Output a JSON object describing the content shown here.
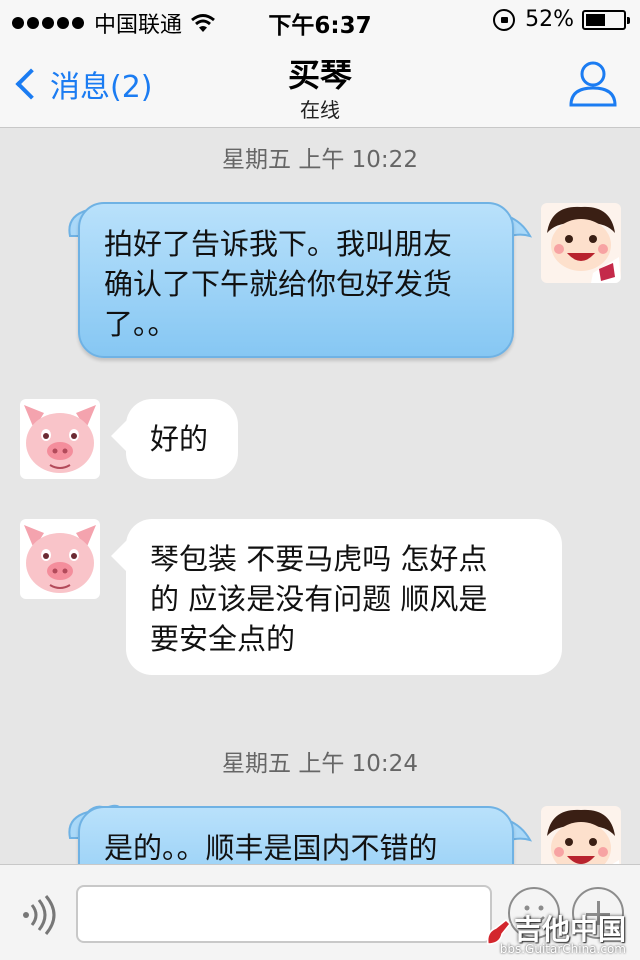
{
  "status_bar": {
    "carrier": "中国联通",
    "time": "下午6:37",
    "battery_percent": "52%",
    "battery_level": 0.52
  },
  "nav": {
    "back_label": "消息(2)",
    "title": "买琴",
    "subtitle": "在线"
  },
  "messages": {
    "ts1": "星期五 上午 10:22",
    "m1": {
      "line1": "拍好了告诉我下。我叫朋友",
      "line2": "确认了下午就给你包好发货",
      "line3": "了。。"
    },
    "m2": {
      "line1": "好的"
    },
    "m3": {
      "line1": "琴包装 不要马虎吗 怎好点",
      "line2": "的 应该是没有问题 顺风是",
      "line3": "要安全点的"
    },
    "ts2": "星期五 上午 10:24",
    "m4": {
      "line1": "是的。。顺丰是国内不错的"
    }
  },
  "input": {
    "value": "",
    "placeholder": ""
  },
  "watermark": {
    "main": "吉他中国",
    "sub": "bbs.GuitarChina.com"
  },
  "colors": {
    "accent": "#1b7cf2",
    "outgoing_bubble": "#9fd3f7",
    "incoming_bubble": "#ffffff",
    "background": "#e6e6e6"
  },
  "icons": {
    "back": "chevron-left-icon",
    "profile": "person-icon",
    "voice": "voice-wave-icon",
    "emoji": "smiley-icon",
    "more": "plus-icon"
  }
}
